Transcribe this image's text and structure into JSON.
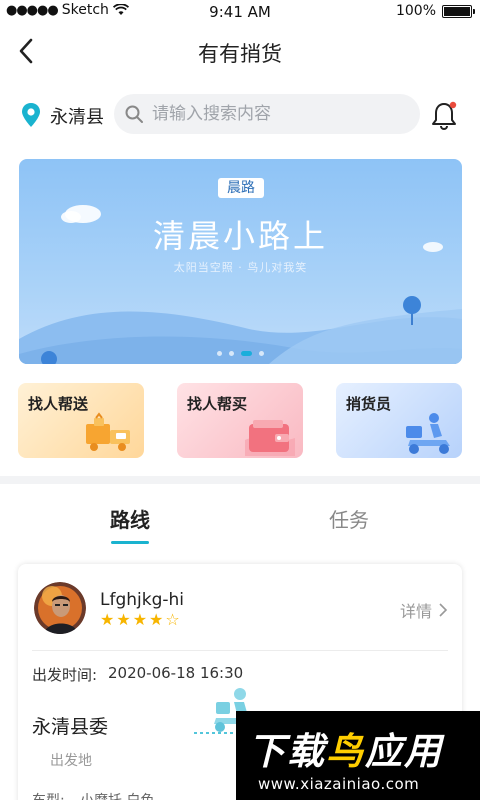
{
  "status_bar": {
    "carrier": "Sketch",
    "time": "9:41 AM",
    "battery": "100%"
  },
  "nav": {
    "title": "有有捎货"
  },
  "search": {
    "location": "永清县",
    "placeholder": "请输入搜索内容"
  },
  "banner": {
    "tag": "晨路",
    "title": "清晨小路上",
    "subtitle": "太阳当空照 · 鸟儿对我笑",
    "active_slide": 3,
    "slide_count": 4
  },
  "services": [
    {
      "label": "找人帮送"
    },
    {
      "label": "找人帮买"
    },
    {
      "label": "捎货员"
    }
  ],
  "tabs": {
    "route": "路线",
    "task": "任务",
    "active": "route"
  },
  "route_card": {
    "user_name": "Lfghjkg-hi",
    "rating": 4,
    "rating_max": 5,
    "detail_label": "详情",
    "depart_label": "出发时间:",
    "depart_time": "2020-06-18 16:30",
    "origin_name": "永清县委",
    "origin_sub": "出发地",
    "vehicle_label": "车型:",
    "vehicle_value": "小摩托 白色"
  },
  "watermark": {
    "title_part1": "下载",
    "title_part2": "鸟",
    "title_part3": "应用",
    "url": "www.xiazainiao.com"
  },
  "colors": {
    "accent": "#1ab3cf",
    "star": "#f7b500",
    "notify_dot": "#e94b3c"
  }
}
